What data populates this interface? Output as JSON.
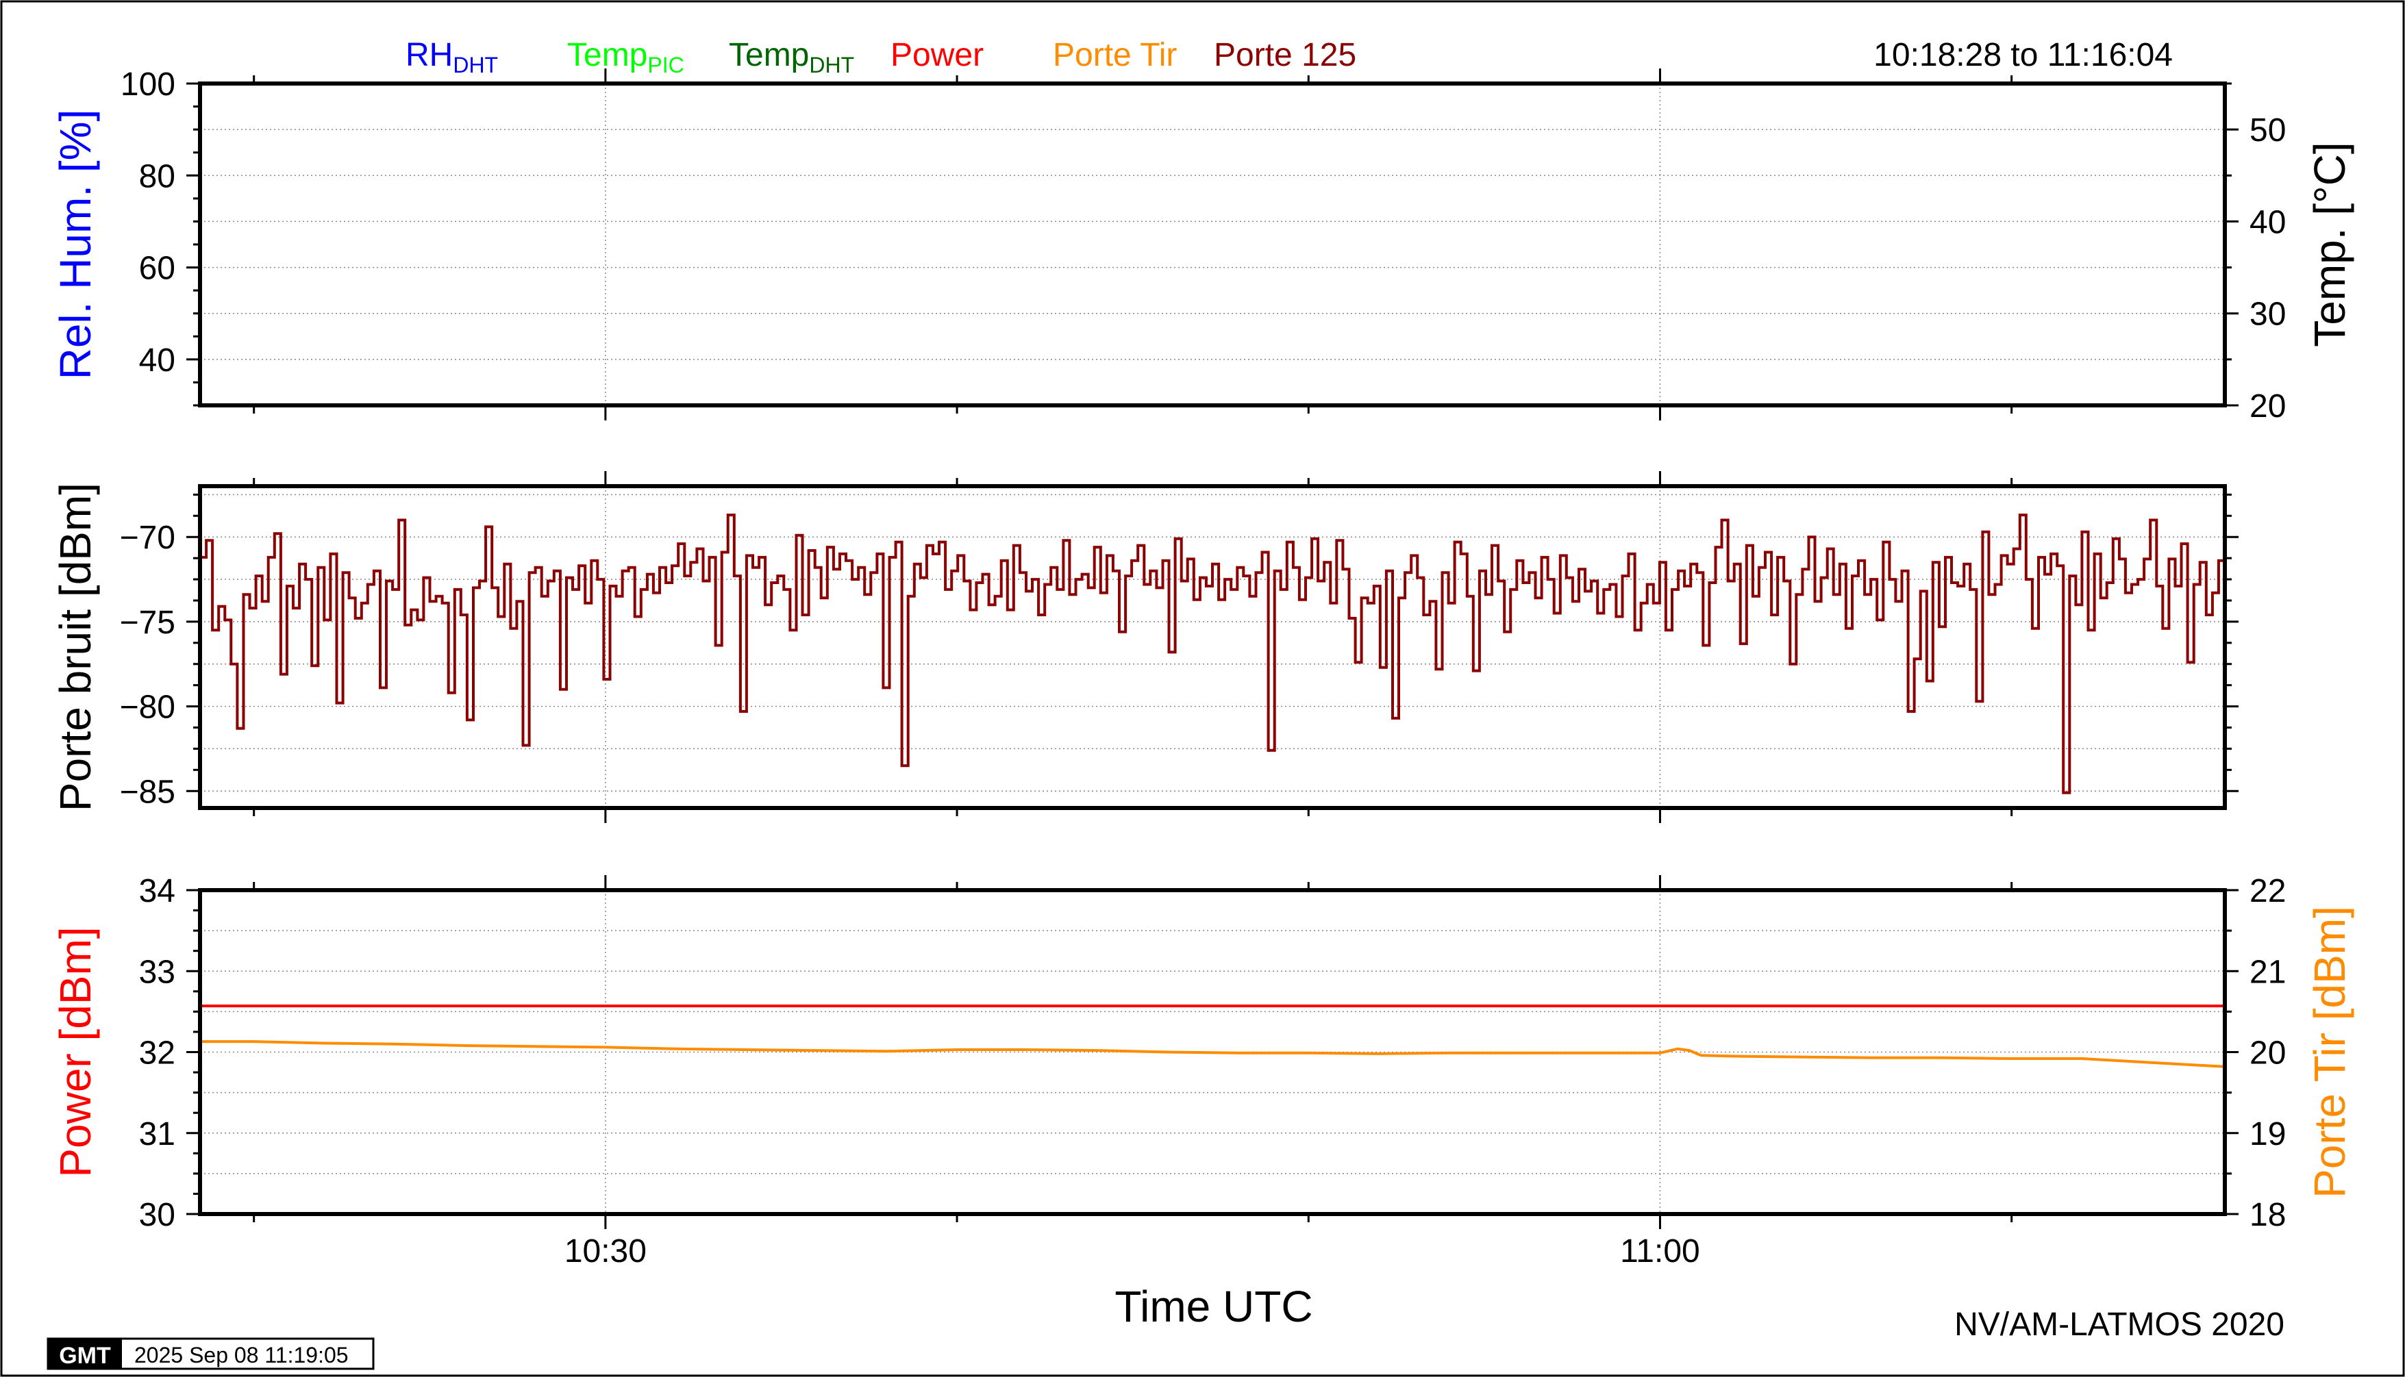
{
  "header": {
    "legend": [
      {
        "main": "RH",
        "sub": "DHT",
        "color": "#0000ff"
      },
      {
        "main": "Temp",
        "sub": "PIC",
        "color": "#00ff00"
      },
      {
        "main": "Temp",
        "sub": "DHT",
        "color": "#006400"
      },
      {
        "main": "Power",
        "sub": "",
        "color": "#ff0000"
      },
      {
        "main": "Porte Tir",
        "sub": "",
        "color": "#ff8c00"
      },
      {
        "main": "Porte 125",
        "sub": "",
        "color": "#8b0000"
      }
    ],
    "time_range": "10:18:28 to 11:16:04"
  },
  "footer": {
    "xlabel": "Time UTC",
    "credit": "NV/AM-LATMOS 2020",
    "gmt_logo": "GMT",
    "timestamp": "2025 Sep 08 11:19:05"
  },
  "chart_data": [
    {
      "type": "line",
      "panel": "humidity-temperature",
      "ylabel_left": "Rel. Hum. [%]",
      "ylabel_right": "Temp. [°C]",
      "ylim_left": [
        30,
        100
      ],
      "ylim_right": [
        20,
        55
      ],
      "yticks_left": [
        40,
        60,
        80,
        100
      ],
      "yticks_right": [
        20,
        30,
        40,
        50
      ],
      "xlim": [
        "10:18:28",
        "11:16:04"
      ],
      "xticks": [
        "10:30",
        "11:00"
      ],
      "grid": true,
      "series": []
    },
    {
      "type": "line",
      "panel": "noise-gate",
      "ylabel_left": "Porte bruit [dBm]",
      "ylim_left": [
        -86,
        -67
      ],
      "yticks_left": [
        -85,
        -80,
        -75,
        -70
      ],
      "xlim": [
        "10:18:28",
        "11:16:04"
      ],
      "xticks": [
        "10:30",
        "11:00"
      ],
      "grid": true,
      "series": [
        {
          "name": "Porte 125",
          "color": "#8b0000",
          "t_start": "10:18:28",
          "t_end": "11:16:04",
          "values": [
            -71.2,
            -70.2,
            -75.5,
            -74.1,
            -74.9,
            -77.5,
            -81.3,
            -73.4,
            -74.2,
            -72.3,
            -73.8,
            -71.2,
            -69.8,
            -78.1,
            -72.9,
            -74.2,
            -71.6,
            -72.5,
            -77.6,
            -71.8,
            -74.9,
            -71.0,
            -79.8,
            -72.1,
            -73.6,
            -74.8,
            -73.9,
            -72.8,
            -72.0,
            -78.9,
            -72.6,
            -73.1,
            -69.0,
            -75.2,
            -74.3,
            -74.9,
            -72.4,
            -73.8,
            -73.5,
            -73.9,
            -79.2,
            -73.1,
            -74.6,
            -80.8,
            -73.0,
            -72.6,
            -69.4,
            -73.0,
            -74.7,
            -71.6,
            -75.4,
            -73.8,
            -82.3,
            -72.1,
            -71.8,
            -73.5,
            -72.6,
            -72.0,
            -79.0,
            -72.4,
            -73.1,
            -71.7,
            -73.9,
            -71.4,
            -72.5,
            -78.4,
            -72.9,
            -73.5,
            -72.0,
            -71.8,
            -74.7,
            -73.1,
            -72.2,
            -73.3,
            -71.8,
            -72.7,
            -71.7,
            -70.4,
            -72.3,
            -71.5,
            -70.7,
            -72.6,
            -71.2,
            -76.4,
            -70.9,
            -68.7,
            -72.3,
            -80.3,
            -71.1,
            -71.8,
            -71.2,
            -74.0,
            -72.7,
            -72.3,
            -73.1,
            -75.5,
            -69.9,
            -74.6,
            -70.8,
            -71.8,
            -73.6,
            -70.6,
            -71.9,
            -71.0,
            -71.4,
            -72.5,
            -71.8,
            -73.4,
            -72.1,
            -71.0,
            -78.9,
            -71.2,
            -70.3,
            -83.5,
            -73.5,
            -71.6,
            -72.4,
            -70.5,
            -71.0,
            -70.3,
            -73.1,
            -72.0,
            -71.1,
            -72.6,
            -74.3,
            -72.7,
            -72.2,
            -74.0,
            -73.5,
            -71.4,
            -74.3,
            -70.5,
            -72.1,
            -73.2,
            -72.5,
            -74.6,
            -72.8,
            -71.8,
            -73.1,
            -70.2,
            -73.4,
            -72.5,
            -72.2,
            -73.0,
            -70.6,
            -73.3,
            -71.1,
            -72.0,
            -75.6,
            -72.3,
            -71.4,
            -70.5,
            -72.8,
            -72.0,
            -73.0,
            -71.4,
            -76.8,
            -70.1,
            -72.6,
            -71.3,
            -73.7,
            -72.4,
            -72.9,
            -71.6,
            -73.7,
            -72.5,
            -73.1,
            -71.8,
            -72.3,
            -73.5,
            -72.1,
            -70.9,
            -82.6,
            -72.0,
            -73.1,
            -70.3,
            -71.8,
            -73.7,
            -72.4,
            -70.1,
            -72.6,
            -71.5,
            -73.9,
            -70.2,
            -71.9,
            -74.8,
            -77.4,
            -73.6,
            -73.9,
            -72.9,
            -77.7,
            -72.0,
            -80.7,
            -73.6,
            -72.1,
            -71.1,
            -72.4,
            -74.6,
            -73.8,
            -77.8,
            -72.1,
            -73.9,
            -70.3,
            -71.0,
            -73.5,
            -77.9,
            -72.0,
            -73.4,
            -70.5,
            -72.6,
            -75.6,
            -73.1,
            -71.4,
            -72.7,
            -72.1,
            -73.6,
            -71.2,
            -72.5,
            -74.5,
            -71.1,
            -72.4,
            -73.8,
            -71.9,
            -73.2,
            -72.6,
            -74.5,
            -73.1,
            -72.8,
            -74.7,
            -72.3,
            -71.0,
            -75.5,
            -73.9,
            -72.8,
            -73.9,
            -71.5,
            -75.5,
            -73.1,
            -72.0,
            -72.9,
            -71.6,
            -72.1,
            -76.4,
            -72.7,
            -70.6,
            -69.0,
            -72.6,
            -71.6,
            -76.3,
            -70.5,
            -73.5,
            -71.8,
            -70.9,
            -74.6,
            -71.2,
            -72.6,
            -77.5,
            -73.4,
            -71.9,
            -70.0,
            -73.8,
            -72.4,
            -70.7,
            -73.4,
            -71.6,
            -75.4,
            -72.3,
            -71.4,
            -73.4,
            -72.5,
            -74.9,
            -70.3,
            -72.5,
            -73.8,
            -72.0,
            -80.3,
            -77.2,
            -73.2,
            -78.5,
            -71.5,
            -75.3,
            -71.2,
            -72.7,
            -72.9,
            -71.6,
            -73.1,
            -79.7,
            -69.7,
            -73.4,
            -72.8,
            -71.1,
            -71.6,
            -70.7,
            -68.7,
            -72.5,
            -75.4,
            -71.2,
            -72.2,
            -71.0,
            -71.7,
            -85.1,
            -72.3,
            -74.0,
            -69.7,
            -75.5,
            -71.0,
            -73.6,
            -72.7,
            -70.1,
            -71.3,
            -73.3,
            -72.8,
            -72.5,
            -71.3,
            -69.0,
            -72.9,
            -75.4,
            -71.3,
            -72.9,
            -70.4,
            -77.4,
            -72.8,
            -71.5,
            -74.6,
            -73.3,
            -71.4,
            -74.6
          ]
        }
      ]
    },
    {
      "type": "line",
      "panel": "power-shot-gate",
      "ylabel_left": "Power [dBm]",
      "ylabel_right": "Porte Tir [dBm]",
      "ylim_left": [
        30,
        34
      ],
      "ylim_right": [
        18,
        22
      ],
      "yticks_left": [
        30,
        31,
        32,
        33,
        34
      ],
      "yticks_right": [
        18,
        19,
        20,
        21,
        22
      ],
      "xlim": [
        "10:18:28",
        "11:16:04"
      ],
      "xticks": [
        "10:30",
        "11:00"
      ],
      "grid": true,
      "series": [
        {
          "name": "Power",
          "axis": "left",
          "color": "#ff0000",
          "t": [
            "10:18:28",
            "11:16:04"
          ],
          "values": [
            32.57,
            32.57
          ]
        },
        {
          "name": "Porte Tir",
          "axis": "right",
          "color": "#ff8c00",
          "t": [
            "10:18:28",
            "10:20:00",
            "10:22:00",
            "10:24:00",
            "10:26:00",
            "10:28:00",
            "10:30:00",
            "10:32:00",
            "10:34:00",
            "10:36:00",
            "10:38:00",
            "10:40:00",
            "10:42:00",
            "10:44:00",
            "10:46:00",
            "10:48:00",
            "10:50:00",
            "10:52:00",
            "10:54:00",
            "10:56:00",
            "10:58:00",
            "11:00:00",
            "11:00:30",
            "11:00:50",
            "11:01:10",
            "11:02:00",
            "11:04:00",
            "11:06:00",
            "11:08:00",
            "11:10:00",
            "11:12:00",
            "11:14:00",
            "11:16:04"
          ],
          "values": [
            20.13,
            20.13,
            20.11,
            20.1,
            20.08,
            20.07,
            20.06,
            20.04,
            20.03,
            20.02,
            20.01,
            20.03,
            20.03,
            20.02,
            20.0,
            19.99,
            19.99,
            19.98,
            19.99,
            19.99,
            19.99,
            19.99,
            20.04,
            20.02,
            19.96,
            19.95,
            19.94,
            19.93,
            19.93,
            19.92,
            19.92,
            19.87,
            19.82
          ]
        }
      ]
    }
  ]
}
